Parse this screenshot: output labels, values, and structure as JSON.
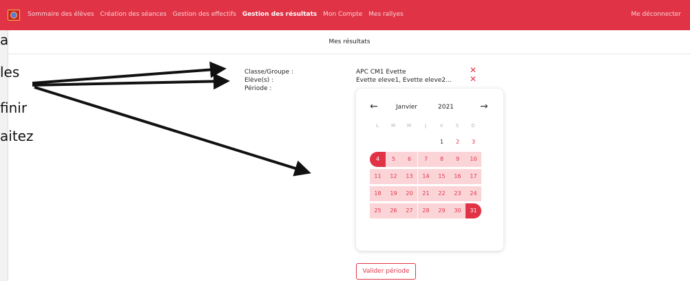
{
  "nav": {
    "items": [
      "Sommaire des élèves",
      "Création des séances",
      "Gestion des effectifs",
      "Gestion des résultats",
      "Mon Compte",
      "Mes rallyes"
    ],
    "active_index": 3,
    "logout": "Me déconnecter"
  },
  "page": {
    "title": "Mes résultats"
  },
  "form": {
    "class_label": "Classe/Groupe :",
    "class_value": "APC CM1 Evette",
    "students_label": "Elève(s) :",
    "students_value": "Evette eleve1, Evette eleve2...",
    "period_label": "Période :",
    "validate_button": "Valider période"
  },
  "calendar": {
    "month": "Janvier",
    "year": "2021",
    "weekdays": [
      "L",
      "M",
      "M",
      "J",
      "V",
      "S",
      "D"
    ],
    "range_start": 4,
    "range_end": 31
  },
  "background_fragments": [
    "asse,",
    "les",
    "finir",
    "aitez"
  ],
  "colors": {
    "accent": "#e03446",
    "range": "#fbd4d8"
  },
  "icons": {
    "prev": "arrow-left",
    "next": "arrow-right",
    "remove": "close-x"
  }
}
